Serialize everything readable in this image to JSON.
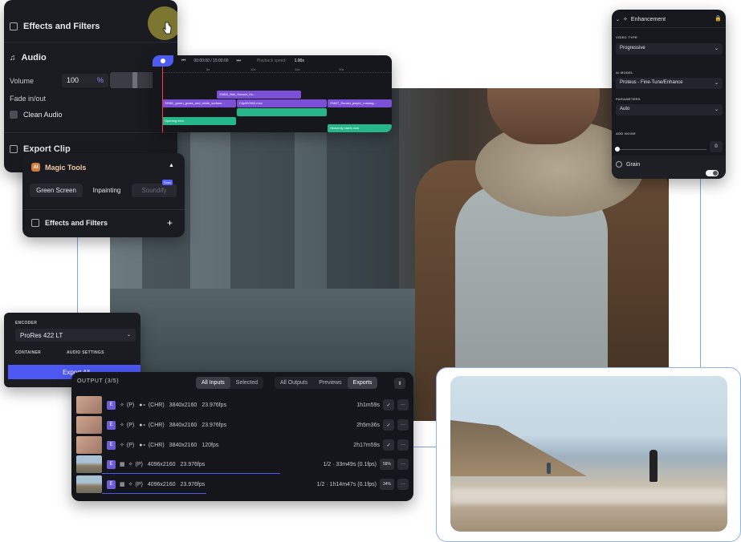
{
  "effects_panel": {
    "title": "Effects and Filters",
    "audio_title": "Audio",
    "volume_label": "Volume",
    "volume_value": "100",
    "volume_unit": "%",
    "fade_label": "Fade in/out",
    "clean_audio_label": "Clean Audio",
    "export_clip_label": "Export Clip"
  },
  "timeline": {
    "timecode": "00:00:00 / 15:00:00",
    "speed_label": "Playback speed:",
    "speed_value": "1.00x",
    "ruler": [
      "5s",
      "10s",
      "15s",
      "20s"
    ],
    "clips": {
      "c1": "23800_Bali_Sunset_Ho...",
      "c2": "78381_green_grass_and_white_surface...",
      "c3": "Clip000003.mov",
      "c4": "23807_Sunset_player_running...",
      "c5": "Opening intro",
      "c6": "Heavenly starts now"
    }
  },
  "magic_tools": {
    "badge": "AI",
    "title": "Magic Tools",
    "tools": [
      "Green Screen",
      "Inpainting",
      "Soundify"
    ],
    "soon_label": "Soon",
    "footer_title": "Effects and Filters"
  },
  "encoder": {
    "encoder_label": "ENCODER",
    "encoder_value": "ProRes 422 LT",
    "container_label": "CONTAINER",
    "audio_label": "AUDIO SETTINGS",
    "export_label": "Export All"
  },
  "output": {
    "title": "OUTPUT (3/5)",
    "filter_tabs": [
      "All Inputs",
      "Selected"
    ],
    "view_tabs": [
      "All Outputs",
      "Previews",
      "Exports"
    ],
    "rows": [
      {
        "badge": "E",
        "tags": "(P)",
        "extra": "(CHR)",
        "res": "3840x2160",
        "fps": "23.976fps",
        "status": "",
        "time": "1h1m59s",
        "action": "✓"
      },
      {
        "badge": "E",
        "tags": "(P)",
        "extra": "(CHR)",
        "res": "3840x2160",
        "fps": "23.976fps",
        "status": "",
        "time": "2h5m36s",
        "action": "✓"
      },
      {
        "badge": "E",
        "tags": "(P)",
        "extra": "(CHR)",
        "res": "3840x2160",
        "fps": "120fps",
        "status": "",
        "time": "2h17m59s",
        "action": "✓"
      },
      {
        "badge": "E",
        "tags": "(P)",
        "extra": "",
        "res": "4096x2160",
        "fps": "23.976fps",
        "status": "1/2 · 33m49s (0.1fps)",
        "time": "",
        "action": "58%"
      },
      {
        "badge": "E",
        "tags": "(P)",
        "extra": "",
        "res": "4096x2160",
        "fps": "23.976fps",
        "status": "1/2 · 1h14m47s (0.1fps)",
        "time": "",
        "action": "34%"
      }
    ],
    "progress": [
      0.58,
      0.34
    ],
    "more_label": "···"
  },
  "enhancement": {
    "title": "Enhancement",
    "video_type_label": "VIDEO TYPE",
    "video_type_value": "Progressive",
    "ai_model_label": "AI MODEL",
    "ai_model_value": "Proteus - Fine-Tune/Enhance",
    "parameters_label": "PARAMETERS",
    "parameters_value": "Auto",
    "noise_label": "ADD NOISE",
    "noise_value": "0",
    "grain_label": "Grain"
  },
  "colors": {
    "accent": "#4c58f2",
    "panel": "#16171c",
    "frame_border": "#8eb2ea"
  }
}
